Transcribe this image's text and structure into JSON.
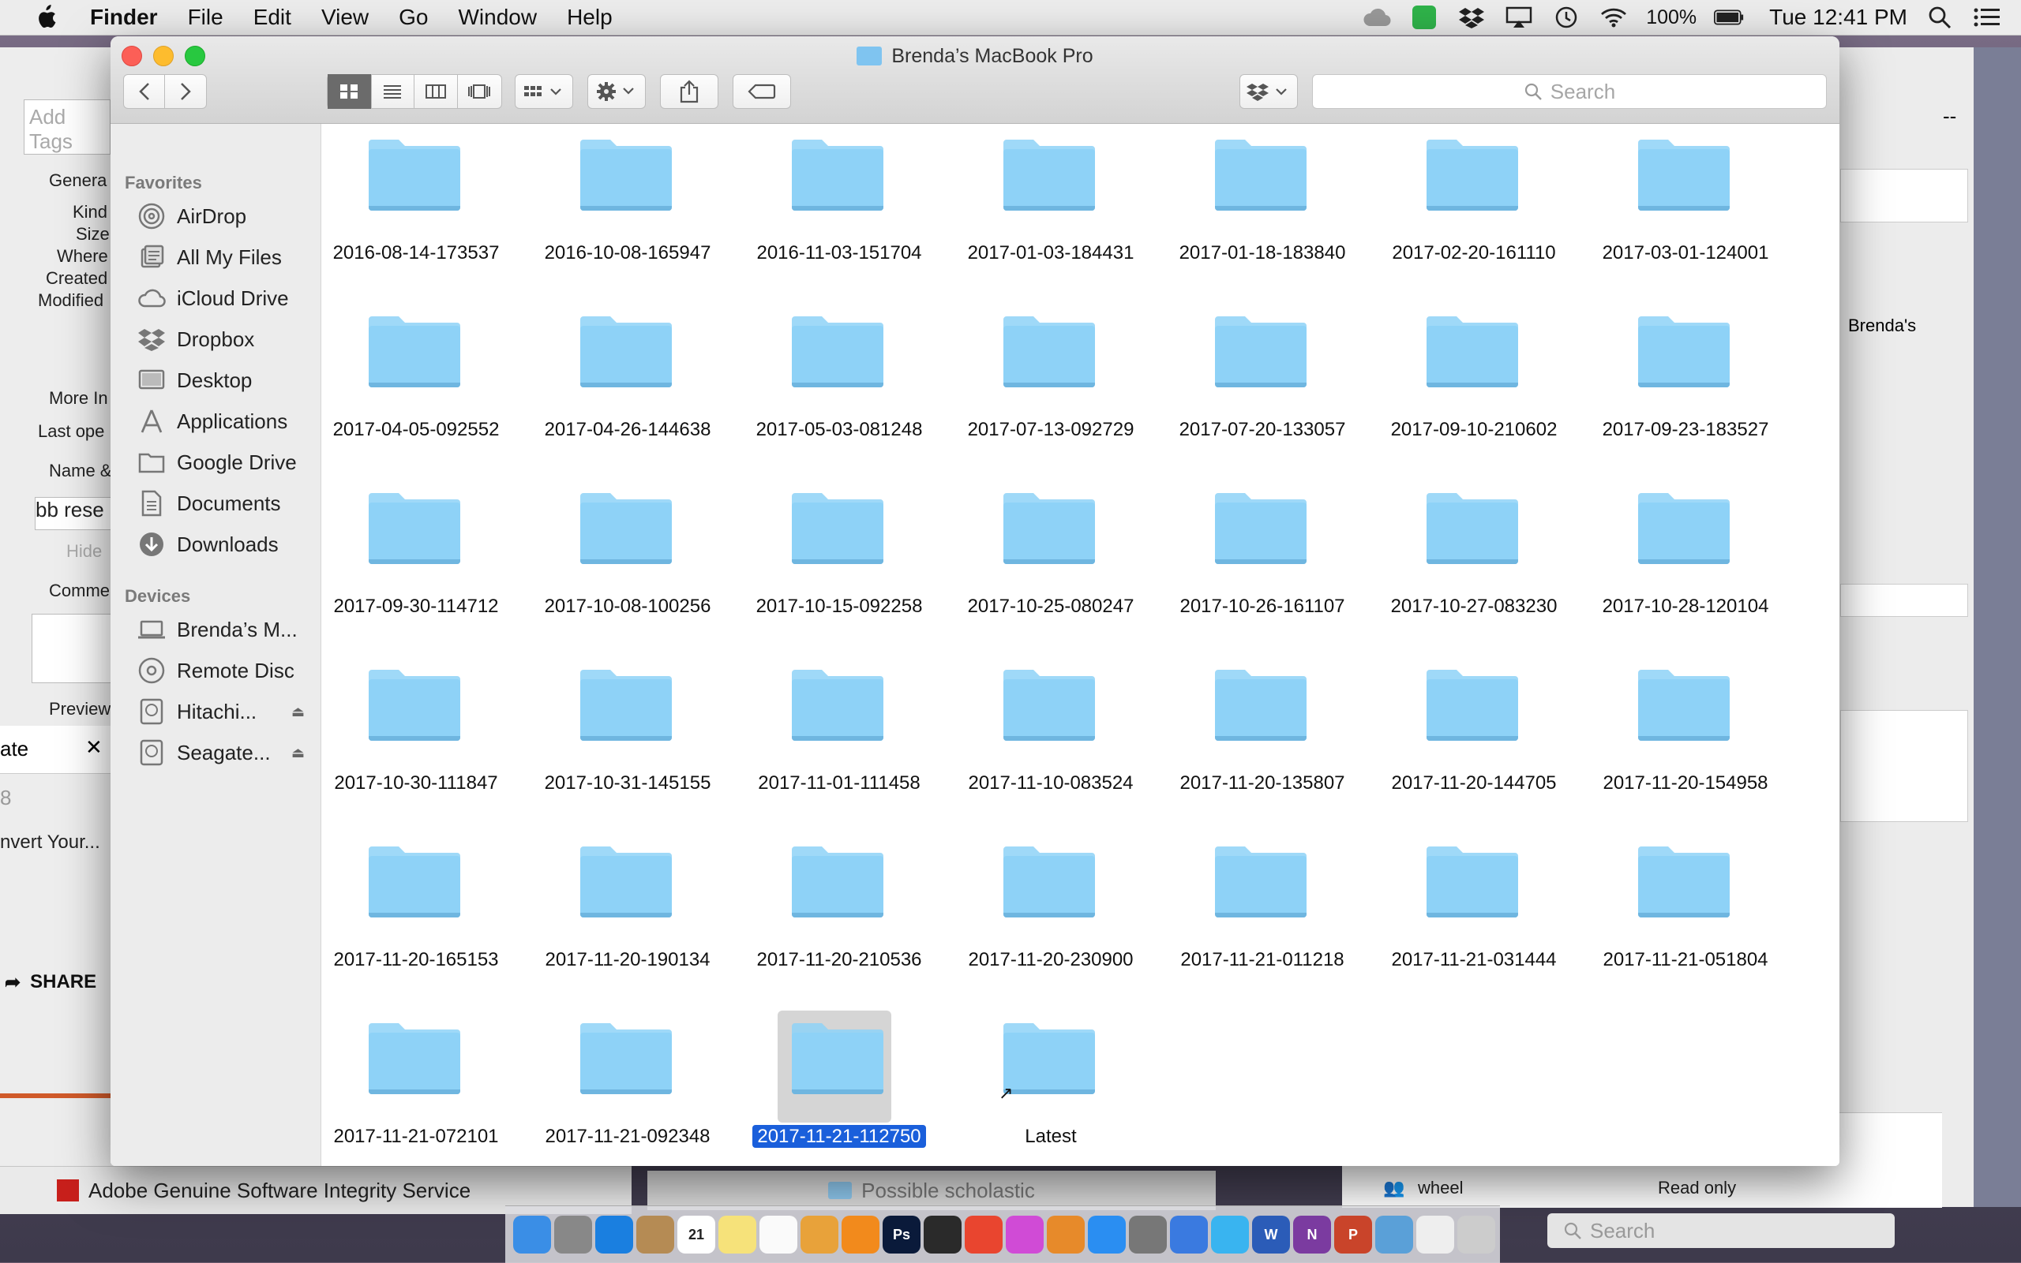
{
  "menubar": {
    "app": "Finder",
    "menus": [
      "File",
      "Edit",
      "View",
      "Go",
      "Window",
      "Help"
    ],
    "battery": "100%",
    "clock": "Tue 12:41 PM"
  },
  "background": {
    "info_rows": [
      "Genera",
      "Kind",
      "Size",
      "Where",
      "Created",
      "Modified",
      "More In",
      "Last ope",
      "Name &",
      "bb rese",
      "Hide",
      "Comme",
      "Preview"
    ],
    "add_tags_placeholder": "Add Tags",
    "left_tab_title": "ate",
    "left_field": "8",
    "left_link": "nvert Your...",
    "share_label": "SHARE",
    "adobe_label": "Adobe Genuine Software Integrity Service",
    "possible_label": "Possible scholastic",
    "right_breadcrumb": "Brenda's",
    "right_dash": "--",
    "perm_user": "wheel",
    "perm_value": "Read only",
    "dock_search_placeholder": "Search"
  },
  "finder": {
    "title": "Brenda’s MacBook Pro",
    "search_placeholder": "Search",
    "sidebar": {
      "favorites_header": "Favorites",
      "favorites": [
        {
          "label": "AirDrop",
          "icon": "airdrop-icon"
        },
        {
          "label": "All My Files",
          "icon": "all-files-icon"
        },
        {
          "label": "iCloud Drive",
          "icon": "cloud-icon"
        },
        {
          "label": "Dropbox",
          "icon": "dropbox-icon"
        },
        {
          "label": "Desktop",
          "icon": "desktop-icon"
        },
        {
          "label": "Applications",
          "icon": "applications-icon"
        },
        {
          "label": "Google Drive",
          "icon": "folder-icon"
        },
        {
          "label": "Documents",
          "icon": "documents-icon"
        },
        {
          "label": "Downloads",
          "icon": "downloads-icon"
        }
      ],
      "devices_header": "Devices",
      "devices": [
        {
          "label": "Brenda’s M...",
          "icon": "laptop-icon",
          "eject": false
        },
        {
          "label": "Remote Disc",
          "icon": "disc-icon",
          "eject": false
        },
        {
          "label": "Hitachi...",
          "icon": "drive-icon",
          "eject": true
        },
        {
          "label": "Seagate...",
          "icon": "drive-icon",
          "eject": true
        }
      ]
    },
    "folders": [
      "2016-08-14-173537",
      "2016-10-08-165947",
      "2016-11-03-151704",
      "2017-01-03-184431",
      "2017-01-18-183840",
      "2017-02-20-161110",
      "2017-03-01-124001",
      "2017-04-05-092552",
      "2017-04-26-144638",
      "2017-05-03-081248",
      "2017-07-13-092729",
      "2017-07-20-133057",
      "2017-09-10-210602",
      "2017-09-23-183527",
      "2017-09-30-114712",
      "2017-10-08-100256",
      "2017-10-15-092258",
      "2017-10-25-080247",
      "2017-10-26-161107",
      "2017-10-27-083230",
      "2017-10-28-120104",
      "2017-10-30-111847",
      "2017-10-31-145155",
      "2017-11-01-111458",
      "2017-11-10-083524",
      "2017-11-20-135807",
      "2017-11-20-144705",
      "2017-11-20-154958",
      "2017-11-20-165153",
      "2017-11-20-190134",
      "2017-11-20-210536",
      "2017-11-20-230900",
      "2017-11-21-011218",
      "2017-11-21-031444",
      "2017-11-21-051804",
      "2017-11-21-072101",
      "2017-11-21-092348",
      "2017-11-21-112750",
      "Latest"
    ],
    "selected_folder": "2017-11-21-112750",
    "alias_folder": "Latest",
    "folder_color": "#8ed2f7",
    "selection_color": "#1a5fdb"
  },
  "dock_apps": [
    "finder",
    "launchpad",
    "safari",
    "contacts",
    "calendar",
    "notes",
    "reminders",
    "photos",
    "vlc",
    "photoshop",
    "quicktime",
    "chrome",
    "itunes",
    "ibooks",
    "app-store",
    "system-preferences",
    "keynote",
    "messages",
    "word",
    "onenote",
    "powerpoint",
    "preview",
    "documents",
    "trash"
  ],
  "dock_calendar_day": "21"
}
